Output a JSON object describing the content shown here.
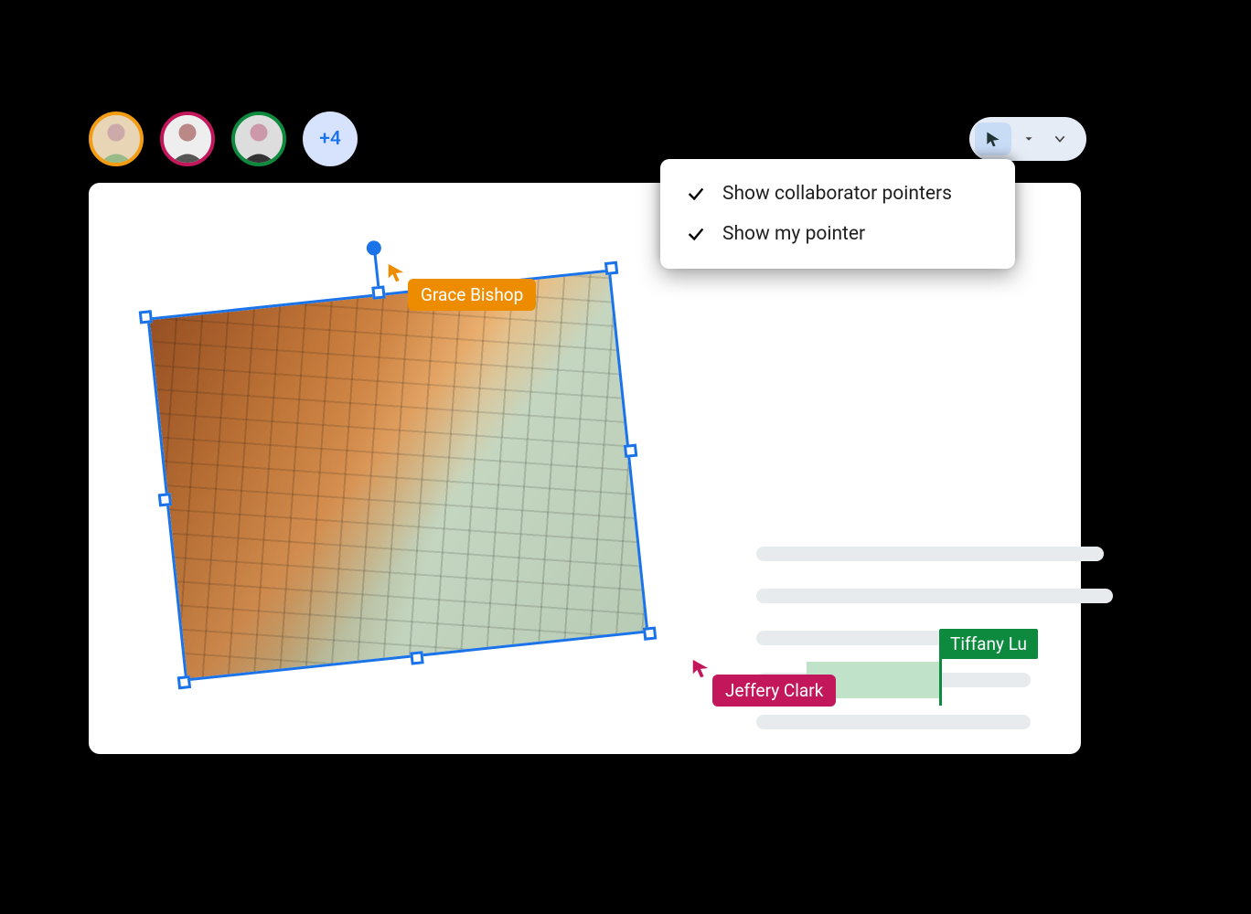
{
  "avatars": {
    "ring_colors": [
      "#f39c12",
      "#c2185b",
      "#0d8a3e"
    ],
    "overflow_label": "+4"
  },
  "toolbar": {
    "cursor_tool": "cursor",
    "caret_tool": "dropdown",
    "chevron_tool": "expand"
  },
  "menu": {
    "items": [
      {
        "label": "Show collaborator pointers",
        "checked": true
      },
      {
        "label": "Show my pointer",
        "checked": true
      }
    ]
  },
  "collaborators": {
    "grace": {
      "name": "Grace Bishop",
      "color": "#ee8c00"
    },
    "jeffery": {
      "name": "Jeffery Clark",
      "color": "#c2185b"
    },
    "tiffany": {
      "name": "Tiffany Lu",
      "color": "#0d8a3e"
    }
  },
  "canvas": {
    "selected_image_alt": "building-photo"
  }
}
